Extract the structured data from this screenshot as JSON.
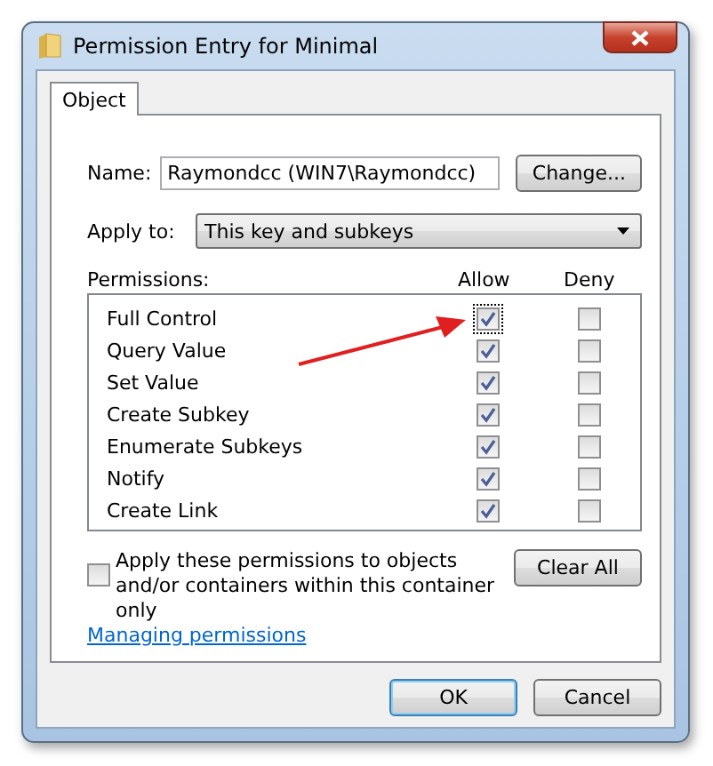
{
  "window": {
    "title": "Permission Entry for Minimal"
  },
  "tabs": [
    {
      "label": "Object",
      "selected": true
    }
  ],
  "name": {
    "label": "Name:",
    "value": "Raymondcc (WIN7\\Raymondcc)",
    "button": "Change..."
  },
  "apply_to": {
    "label": "Apply to:",
    "value": "This key and subkeys"
  },
  "permissions": {
    "label": "Permissions:",
    "columns": [
      "Allow",
      "Deny"
    ],
    "rows": [
      {
        "name": "Full Control",
        "allow": true,
        "deny": false,
        "focused": true
      },
      {
        "name": "Query Value",
        "allow": true,
        "deny": false,
        "focused": false
      },
      {
        "name": "Set Value",
        "allow": true,
        "deny": false,
        "focused": false
      },
      {
        "name": "Create Subkey",
        "allow": true,
        "deny": false,
        "focused": false
      },
      {
        "name": "Enumerate Subkeys",
        "allow": true,
        "deny": false,
        "focused": false
      },
      {
        "name": "Notify",
        "allow": true,
        "deny": false,
        "focused": false
      },
      {
        "name": "Create Link",
        "allow": true,
        "deny": false,
        "focused": false
      }
    ]
  },
  "apply_inherit": {
    "label": "Apply these permissions to objects and/or containers within this container only",
    "checked": false
  },
  "clear_button": "Clear All",
  "link": "Managing permissions",
  "buttons": [
    {
      "label": "OK",
      "default": true
    },
    {
      "label": "Cancel",
      "default": false
    }
  ]
}
